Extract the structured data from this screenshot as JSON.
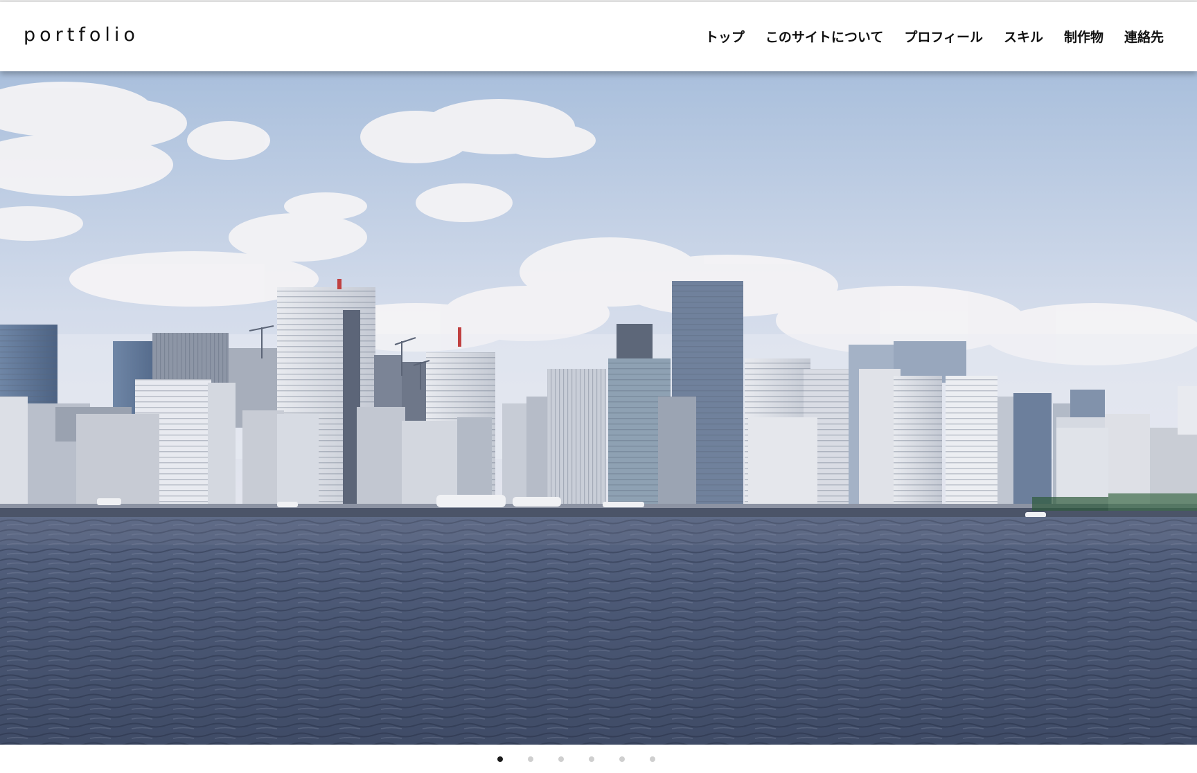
{
  "header": {
    "logo": "portfolio",
    "nav": [
      {
        "label": "トップ"
      },
      {
        "label": "このサイトについて"
      },
      {
        "label": "プロフィール"
      },
      {
        "label": "スキル"
      },
      {
        "label": "制作物"
      },
      {
        "label": "連絡先"
      }
    ]
  },
  "hero": {
    "image_subject": "city-skyline-over-water-photo"
  },
  "slider": {
    "total_slides": 6,
    "active_index": 0
  },
  "colors": {
    "sky": "#b7c9e0",
    "water": "#4d5a73",
    "active_dot": "#1a1a1a",
    "inactive_dot": "#cfcfcf"
  }
}
